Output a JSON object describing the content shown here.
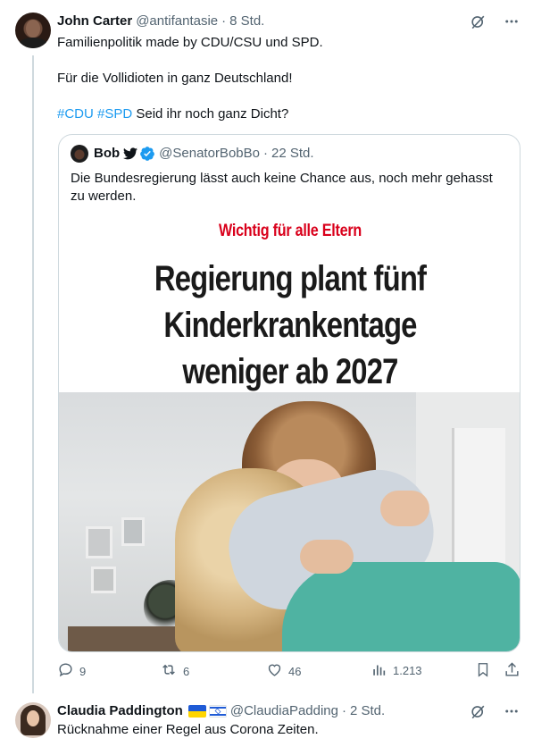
{
  "tweets": [
    {
      "name": "John Carter",
      "handle": "@antifantasie",
      "separator": "·",
      "time": "8 Std.",
      "text_lines": [
        "Familienpolitik made by CDU/CSU und SPD.",
        "Für die Vollidioten in ganz Deutschland!"
      ],
      "hashtags": [
        "#CDU",
        "#SPD"
      ],
      "hashtag_suffix": " Seid ihr noch ganz Dicht?",
      "quote": {
        "name": "Bob",
        "handle": "@SenatorBobBo",
        "separator": "·",
        "time": "22 Std.",
        "text": "Die Bundesregierung lässt auch keine Chance aus, noch mehr gehasst zu werden.",
        "kicker": "Wichtig für alle Eltern",
        "headline": "Regierung plant fünf Kinderkrankentage weniger ab 2027"
      },
      "actions": {
        "replies": "9",
        "reposts": "6",
        "likes": "46",
        "views": "1.213"
      }
    },
    {
      "name": "Claudia Paddington",
      "handle": "@ClaudiaPadding",
      "separator": "·",
      "time": "2 Std.",
      "text": "Rücknahme einer Regel aus Corona Zeiten."
    }
  ],
  "icons": {
    "grok": "grok-icon",
    "more": "more-icon",
    "reply": "reply-icon",
    "repost": "repost-icon",
    "like": "like-icon",
    "views": "views-icon",
    "bookmark": "bookmark-icon",
    "share": "share-icon",
    "verified": "verified-badge-icon",
    "bird": "bird-emoji-icon"
  },
  "colors": {
    "accent": "#1d9bf0",
    "muted": "#536471",
    "kicker_red": "#d9001b"
  }
}
